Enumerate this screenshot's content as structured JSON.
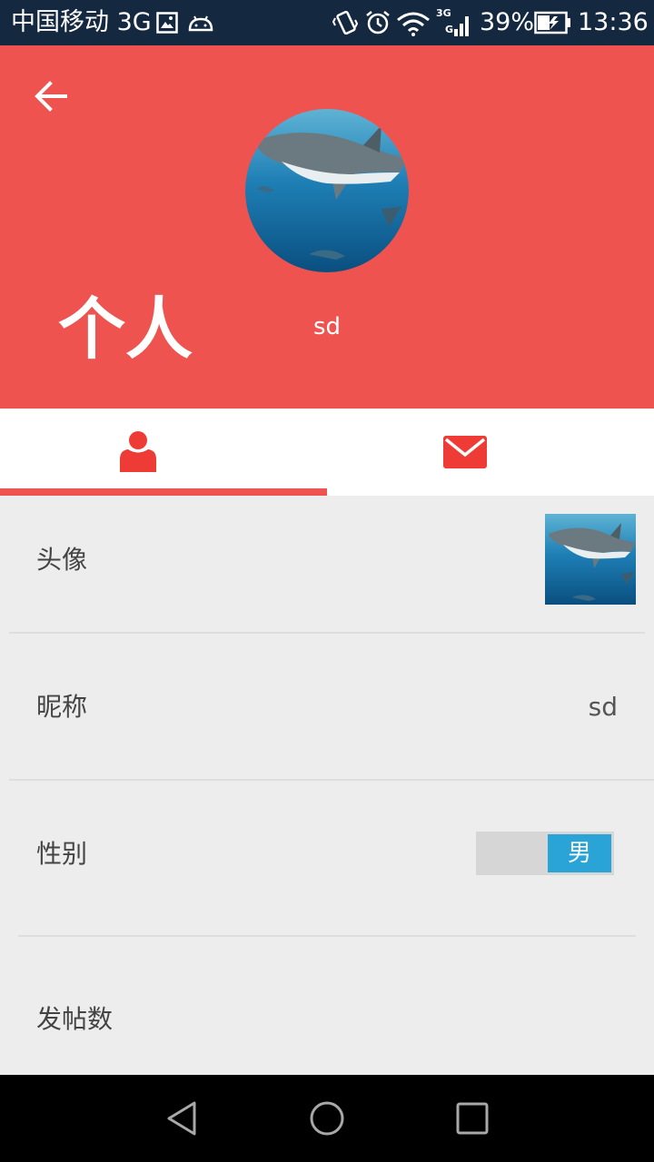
{
  "status_bar": {
    "carrier": "中国移动 3G",
    "battery_percent": "39%",
    "time": "13:36",
    "icons": [
      "image-icon",
      "android-icon",
      "vibrate-icon",
      "alarm-icon",
      "wifi-icon",
      "signal-icon",
      "battery-icon"
    ]
  },
  "header": {
    "title": "个人",
    "username": "sd",
    "background_color": "#ef5350",
    "back_icon": "arrow-left-icon",
    "avatar_icon": "shark-photo"
  },
  "tabs": {
    "items": [
      {
        "icon": "person-icon",
        "selected": true
      },
      {
        "icon": "envelope-icon",
        "selected": false
      }
    ],
    "accent_color": "#ef5350"
  },
  "profile": {
    "avatar_label": "头像",
    "nickname_label": "昵称",
    "nickname_value": "sd",
    "gender_label": "性别",
    "gender_value": "男",
    "gender_toggle_color": "#2aa3d6",
    "posts_label": "发帖数"
  },
  "nav_bar": {
    "icons": [
      "back-triangle-icon",
      "home-circle-icon",
      "recents-square-icon"
    ]
  }
}
